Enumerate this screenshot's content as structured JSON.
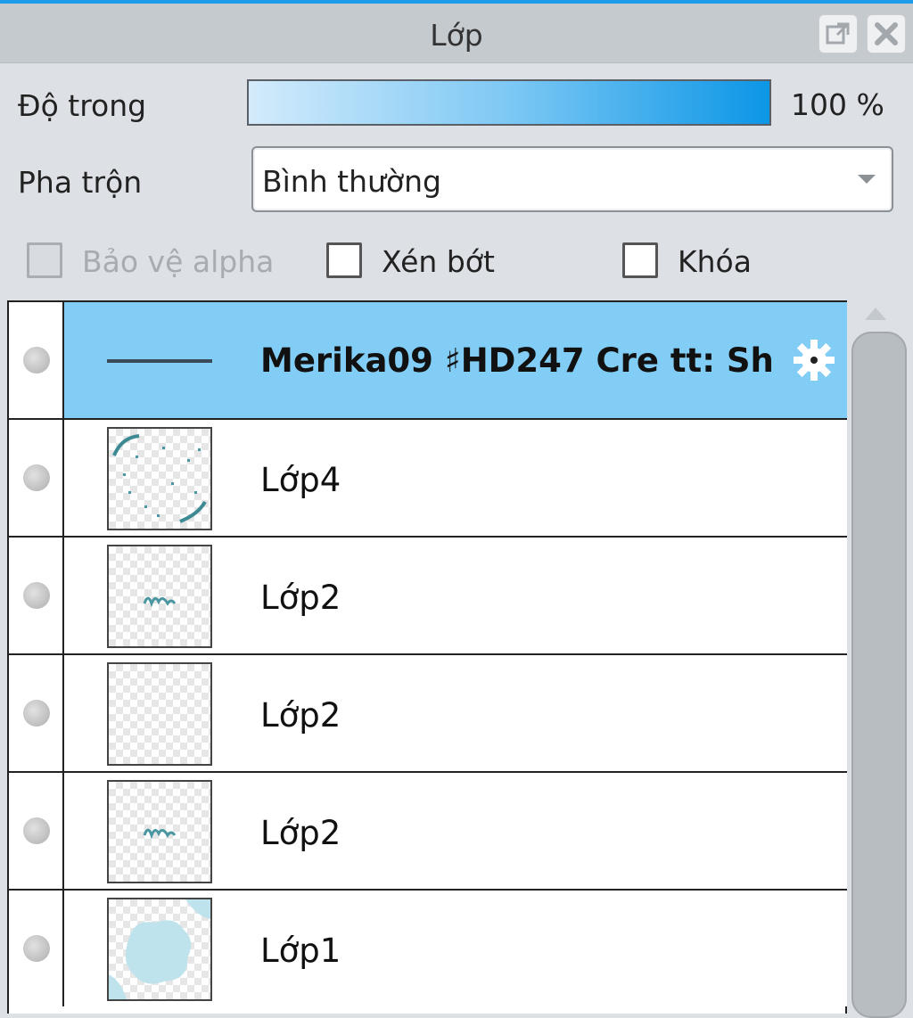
{
  "panel": {
    "title": "Lớp",
    "popout_icon": "popout-icon",
    "close_icon": "close-icon"
  },
  "opacity": {
    "label": "Độ trong",
    "value_text": "100 %",
    "value": 100
  },
  "blend": {
    "label": "Pha trộn",
    "selected": "Bình thường"
  },
  "options": {
    "alpha_protect": {
      "label": "Bảo vệ alpha",
      "checked": false,
      "disabled": true
    },
    "clip": {
      "label": "Xén bớt",
      "checked": false
    },
    "lock": {
      "label": "Khóa",
      "checked": false
    }
  },
  "layers": [
    {
      "name": "Merika09 ♯HD247 Cre tt: Sh",
      "selected": true,
      "type": "folder",
      "icon": "gear-icon"
    },
    {
      "name": "Lớp4",
      "selected": false,
      "type": "layer"
    },
    {
      "name": "Lớp2",
      "selected": false,
      "type": "layer"
    },
    {
      "name": "Lớp2",
      "selected": false,
      "type": "layer"
    },
    {
      "name": "Lớp2",
      "selected": false,
      "type": "layer"
    },
    {
      "name": "Lớp1",
      "selected": false,
      "type": "layer"
    }
  ],
  "colors": {
    "accent": "#1e9be9",
    "selected_row": "#82cdf5",
    "titlebar": "#c5cacf",
    "background": "#dde1e5"
  }
}
